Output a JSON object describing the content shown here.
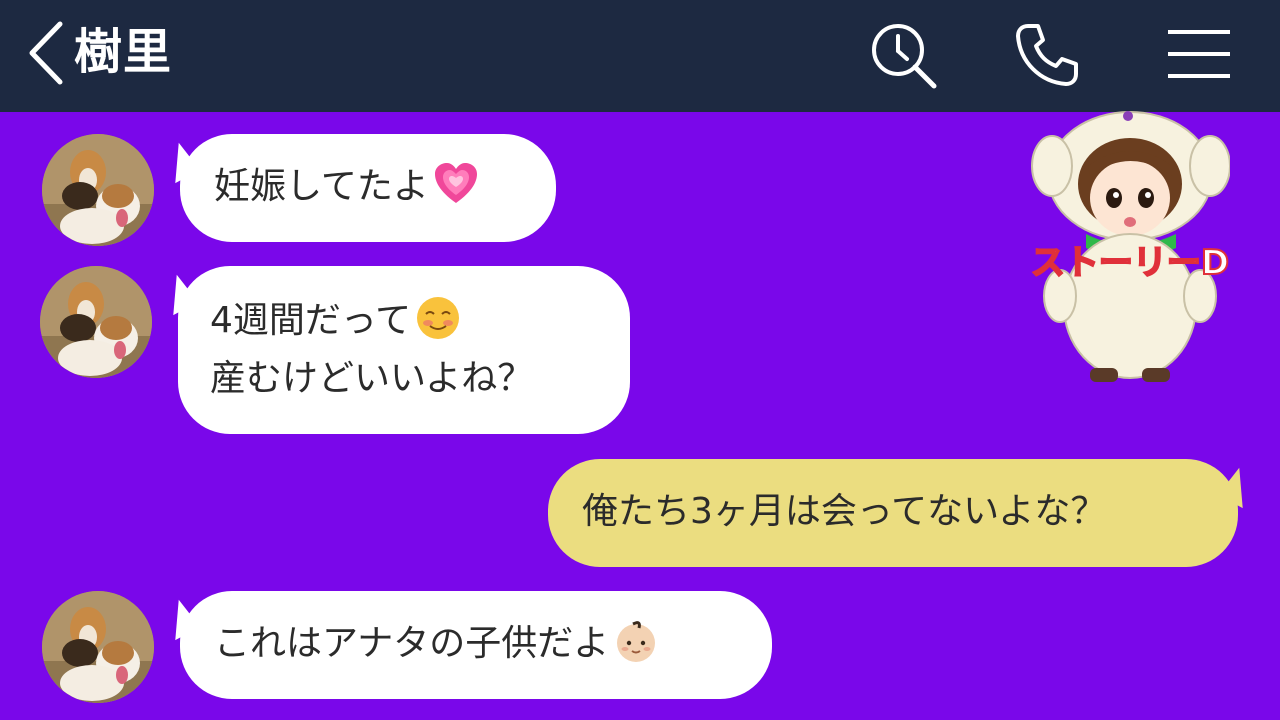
{
  "header": {
    "title": "樹里",
    "icons": [
      "back-chevron-icon",
      "search-clock-icon",
      "phone-icon",
      "menu-icon"
    ],
    "background": "#1d2941"
  },
  "chat": {
    "background": "#7a07ea",
    "messages": [
      {
        "sender": "other",
        "line1": "妊娠してたよ",
        "emoji": "growing-heart-emoji"
      },
      {
        "sender": "other",
        "line1": "4週間だって",
        "line2": "産むけどいいよね？",
        "emoji": "smiling-blush-emoji"
      },
      {
        "sender": "me",
        "line1": "俺たち3ヶ月は会ってないよな？"
      },
      {
        "sender": "other",
        "line1": "これはアナタの子供だよ",
        "emoji": "baby-emoji"
      }
    ],
    "incoming_bubble_color": "#ffffff",
    "outgoing_bubble_color": "#ebdd80"
  },
  "mascot": {
    "logo_text": "ストーリーD"
  }
}
